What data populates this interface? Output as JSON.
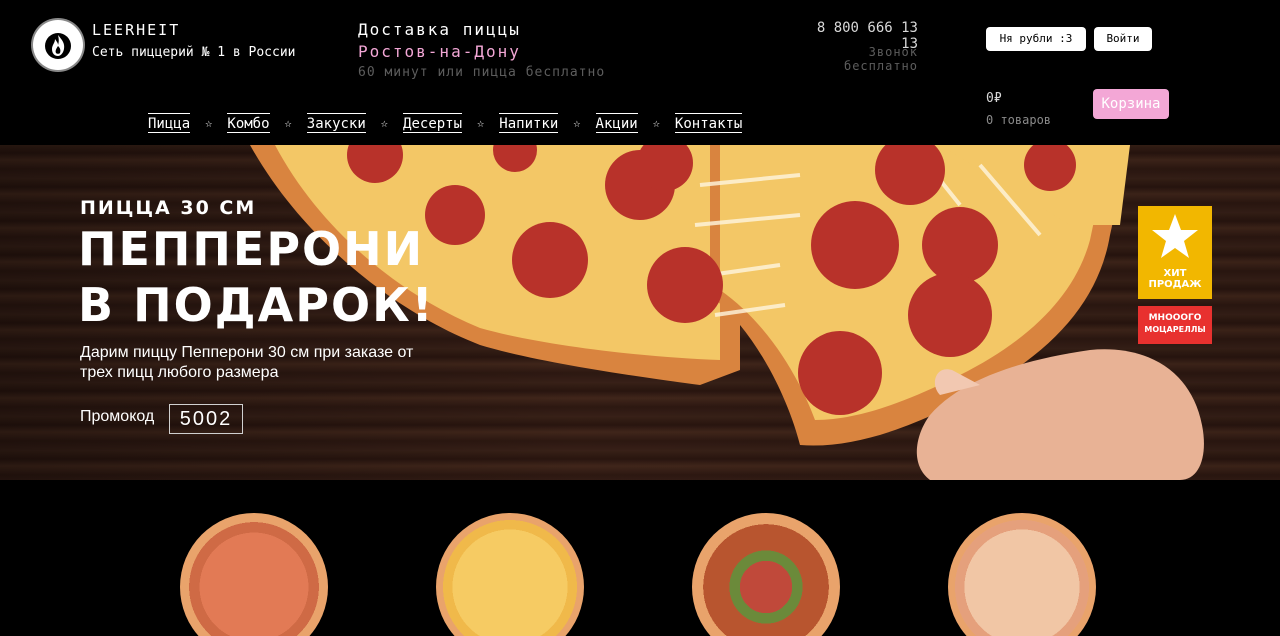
{
  "header": {
    "brand_name": "LEERHEIT",
    "brand_tagline": "Сеть пиццерий № 1 в России",
    "delivery_title": "Доставка пиццы",
    "delivery_city": "Ростов-на-Дону",
    "delivery_promise": "60 минут или пицца бесплатно",
    "phone": "8 800 666 13 13",
    "phone_note": "Звонок бесплатно",
    "currency_button": "Ня рубли :3",
    "login_button": "Войти",
    "cart_sum": "0₽",
    "cart_count": "0 товаров",
    "cart_button": "Корзина"
  },
  "nav": {
    "items": [
      {
        "label": "Пицца"
      },
      {
        "label": "Комбо"
      },
      {
        "label": "Закуски"
      },
      {
        "label": "Десерты"
      },
      {
        "label": "Напитки"
      },
      {
        "label": "Акции"
      },
      {
        "label": "Контакты"
      }
    ],
    "separator": "☆"
  },
  "hero": {
    "subtitle": "ПИЦЦА 30 СМ",
    "title_line1": "ПЕППЕРОНИ",
    "title_line2": "В ПОДАРОК!",
    "description": "Дарим пиццу Пепперони 30 см при заказе от трех пицц любого размера",
    "promo_label": "Промокод",
    "promo_code": "5002",
    "badge_hit": "ХИТ ПРОДАЖ",
    "badge_moz_line1": "МНОООГО",
    "badge_moz_line2": "МОЦАРЕЛЛЫ"
  },
  "colors": {
    "accent_pink": "#f3a7d6",
    "badge_yellow": "#f2b700",
    "badge_red": "#e8312f"
  },
  "products": [
    {
      "icon": "pizza-ham-icon"
    },
    {
      "icon": "pizza-cheese-icon"
    },
    {
      "icon": "pizza-supreme-icon"
    },
    {
      "icon": "pizza-chicken-icon"
    }
  ]
}
